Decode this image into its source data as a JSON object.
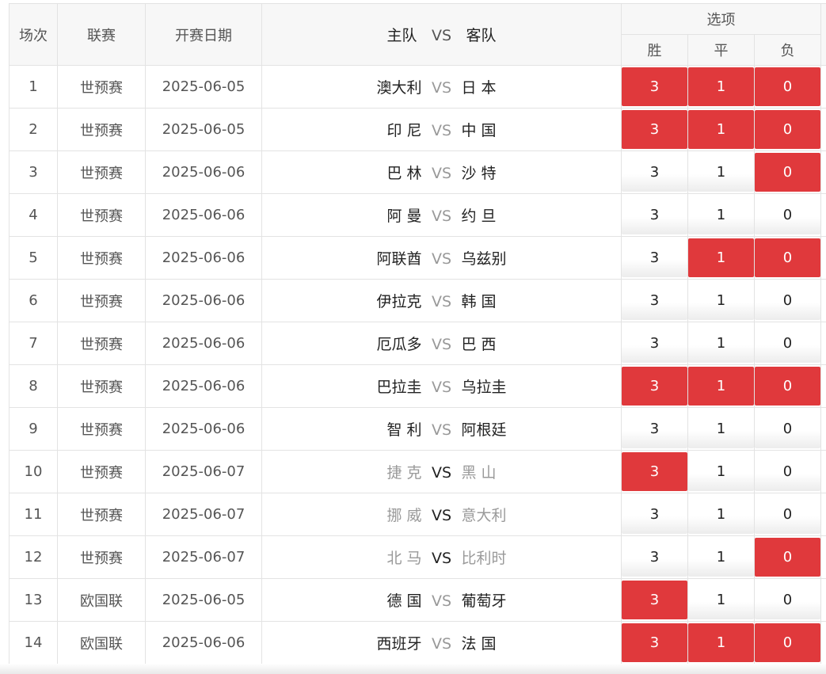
{
  "header": {
    "round": "场次",
    "league": "联赛",
    "date": "开赛日期",
    "home": "主队",
    "vs": "VS",
    "away": "客队",
    "options": "选项",
    "win": "胜",
    "draw": "平",
    "lose": "负"
  },
  "colors": {
    "selected": "#e0393c",
    "header_bg": "#f7f7f7"
  },
  "rows": [
    {
      "no": "1",
      "league": "世预赛",
      "date": "2025-06-05",
      "home": "澳大利",
      "vs": "VS",
      "away": "日 本",
      "opts": [
        "3",
        "1",
        "0"
      ],
      "sel": [
        true,
        true,
        true
      ],
      "neutral": false
    },
    {
      "no": "2",
      "league": "世预赛",
      "date": "2025-06-05",
      "home": "印 尼",
      "vs": "VS",
      "away": "中 国",
      "opts": [
        "3",
        "1",
        "0"
      ],
      "sel": [
        true,
        true,
        true
      ],
      "neutral": false
    },
    {
      "no": "3",
      "league": "世预赛",
      "date": "2025-06-06",
      "home": "巴 林",
      "vs": "VS",
      "away": "沙 特",
      "opts": [
        "3",
        "1",
        "0"
      ],
      "sel": [
        false,
        false,
        true
      ],
      "neutral": false
    },
    {
      "no": "4",
      "league": "世预赛",
      "date": "2025-06-06",
      "home": "阿 曼",
      "vs": "VS",
      "away": "约 旦",
      "opts": [
        "3",
        "1",
        "0"
      ],
      "sel": [
        false,
        false,
        false
      ],
      "neutral": false
    },
    {
      "no": "5",
      "league": "世预赛",
      "date": "2025-06-06",
      "home": "阿联酋",
      "vs": "VS",
      "away": "乌兹别",
      "opts": [
        "3",
        "1",
        "0"
      ],
      "sel": [
        false,
        true,
        true
      ],
      "neutral": false
    },
    {
      "no": "6",
      "league": "世预赛",
      "date": "2025-06-06",
      "home": "伊拉克",
      "vs": "VS",
      "away": "韩 国",
      "opts": [
        "3",
        "1",
        "0"
      ],
      "sel": [
        false,
        false,
        false
      ],
      "neutral": false
    },
    {
      "no": "7",
      "league": "世预赛",
      "date": "2025-06-06",
      "home": "厄瓜多",
      "vs": "VS",
      "away": "巴 西",
      "opts": [
        "3",
        "1",
        "0"
      ],
      "sel": [
        false,
        false,
        false
      ],
      "neutral": false
    },
    {
      "no": "8",
      "league": "世预赛",
      "date": "2025-06-06",
      "home": "巴拉圭",
      "vs": "VS",
      "away": "乌拉圭",
      "opts": [
        "3",
        "1",
        "0"
      ],
      "sel": [
        true,
        true,
        true
      ],
      "neutral": false
    },
    {
      "no": "9",
      "league": "世预赛",
      "date": "2025-06-06",
      "home": "智 利",
      "vs": "VS",
      "away": "阿根廷",
      "opts": [
        "3",
        "1",
        "0"
      ],
      "sel": [
        false,
        false,
        false
      ],
      "neutral": false
    },
    {
      "no": "10",
      "league": "世预赛",
      "date": "2025-06-07",
      "home": "捷 克",
      "vs": "VS",
      "away": "黑 山",
      "opts": [
        "3",
        "1",
        "0"
      ],
      "sel": [
        true,
        false,
        false
      ],
      "neutral": true
    },
    {
      "no": "11",
      "league": "世预赛",
      "date": "2025-06-07",
      "home": "挪 威",
      "vs": "VS",
      "away": "意大利",
      "opts": [
        "3",
        "1",
        "0"
      ],
      "sel": [
        false,
        false,
        false
      ],
      "neutral": true
    },
    {
      "no": "12",
      "league": "世预赛",
      "date": "2025-06-07",
      "home": "北 马",
      "vs": "VS",
      "away": "比利时",
      "opts": [
        "3",
        "1",
        "0"
      ],
      "sel": [
        false,
        false,
        true
      ],
      "neutral": true
    },
    {
      "no": "13",
      "league": "欧国联",
      "date": "2025-06-05",
      "home": "德 国",
      "vs": "VS",
      "away": "葡萄牙",
      "opts": [
        "3",
        "1",
        "0"
      ],
      "sel": [
        true,
        false,
        false
      ],
      "neutral": false
    },
    {
      "no": "14",
      "league": "欧国联",
      "date": "2025-06-06",
      "home": "西班牙",
      "vs": "VS",
      "away": "法 国",
      "opts": [
        "3",
        "1",
        "0"
      ],
      "sel": [
        true,
        true,
        true
      ],
      "neutral": false
    }
  ]
}
